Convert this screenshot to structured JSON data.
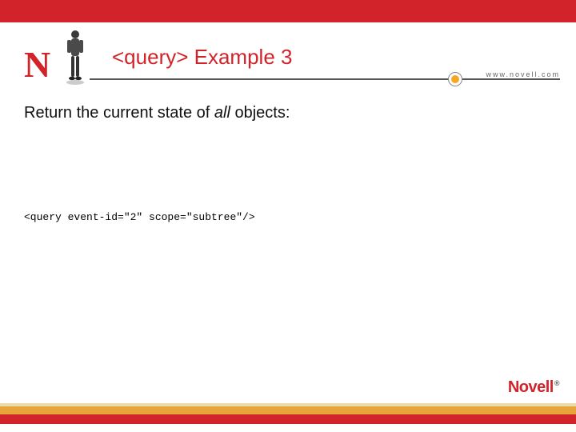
{
  "header": {
    "title": "<query> Example 3",
    "url": "www.novell.com"
  },
  "body": {
    "prefix": "Return the current state of ",
    "italic": "all",
    "suffix": " objects:"
  },
  "code": {
    "line": "<query event-id=\"2\" scope=\"subtree\"/>"
  },
  "footer": {
    "brand": "Novell",
    "reg": "®"
  }
}
